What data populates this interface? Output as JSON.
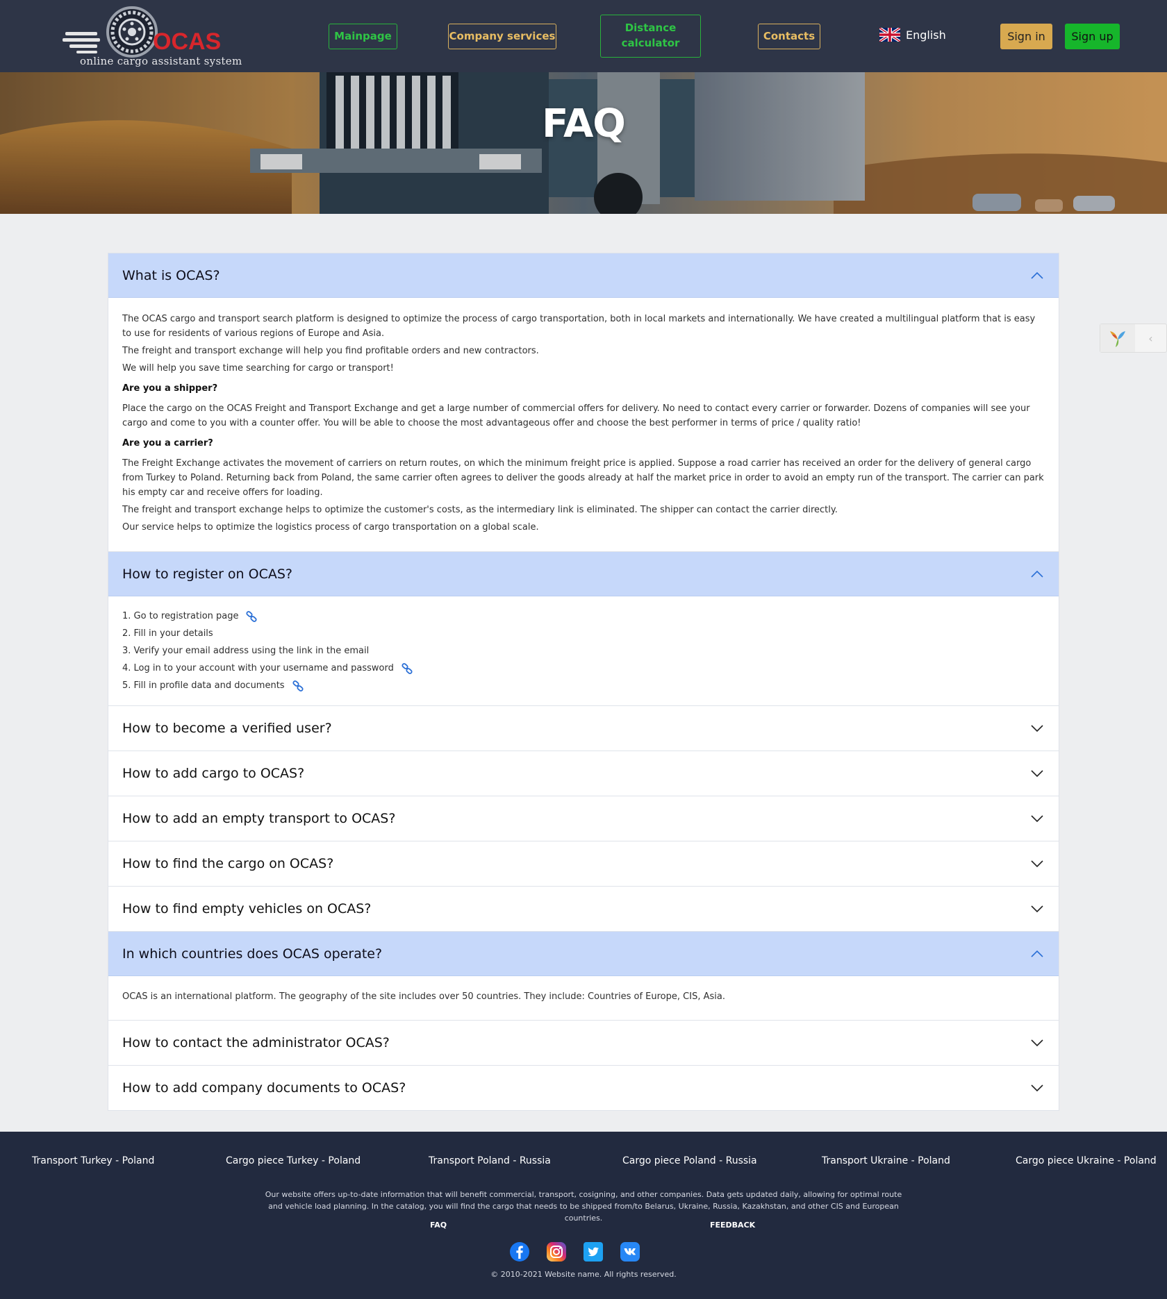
{
  "header": {
    "logo_text": "OCAS",
    "logo_tagline": "online cargo assistant system",
    "nav": {
      "mainpage": "Mainpage",
      "company_services": "Company services",
      "distance_line1": "Distance",
      "distance_line2": "calculator",
      "contacts": "Contacts"
    },
    "language": "English",
    "signin": "Sign in",
    "signup": "Sign up"
  },
  "hero": {
    "title": "FAQ"
  },
  "faq": {
    "q1": {
      "question": "What is OCAS?",
      "p1": "The OCAS cargo and transport search platform is designed to optimize the process of cargo transportation, both in local markets and internationally. We have created a multilingual platform that is easy to use for residents of various regions of Europe and Asia.",
      "p2": "The freight and transport exchange will help you find profitable orders and new contractors.",
      "p3": "We will help you save time searching for cargo or transport!",
      "h_shipper": "Are you a shipper?",
      "p4": "Place the cargo on the OCAS Freight and Transport Exchange and get a large number of commercial offers for delivery. No need to contact every carrier or forwarder. Dozens of companies will see your cargo and come to you with a counter offer. You will be able to choose the most advantageous offer and choose the best performer in terms of price / quality ratio!",
      "h_carrier": "Are you a carrier?",
      "p5": "The Freight Exchange activates the movement of carriers on return routes, on which the minimum freight price is applied. Suppose a road carrier has received an order for the delivery of general cargo from Turkey to Poland. Returning back from Poland, the same carrier often agrees to deliver the goods already at half the market price in order to avoid an empty run of the transport. The carrier can park his empty car and receive offers for loading.",
      "p6": "The freight and transport exchange helps to optimize the customer's costs, as the intermediary link is eliminated. The shipper can contact the carrier directly.",
      "p7": "Our service helps to optimize the logistics process of cargo transportation on a global scale."
    },
    "q2": {
      "question": "How to register on OCAS?",
      "steps": [
        "1. Go to registration page",
        "2. Fill in your details",
        "3. Verify your email address using the link in the email",
        "4. Log in to your account with your username and password",
        "5. Fill in profile data and documents"
      ]
    },
    "q3": {
      "question": "How to become a verified user?"
    },
    "q4": {
      "question": "How to add cargo to OCAS?"
    },
    "q5": {
      "question": "How to add an empty transport to OCAS?"
    },
    "q6": {
      "question": "How to find the cargo on OCAS?"
    },
    "q7": {
      "question": "How to find empty vehicles on OCAS?"
    },
    "q8": {
      "question": "In which countries does OCAS operate?",
      "answer": "OCAS is an international platform. The geography of the site includes over 50 countries. They include: Countries of Europe, CIS, Asia."
    },
    "q9": {
      "question": "How to contact the administrator OCAS?"
    },
    "q10": {
      "question": "How to add company documents to OCAS?"
    }
  },
  "footer": {
    "links": [
      "Transport Turkey - Poland",
      "Cargo piece Turkey - Poland",
      "Transport Poland - Russia",
      "Cargo piece Poland - Russia",
      "Transport Ukraine - Poland",
      "Cargo piece Ukraine - Poland"
    ],
    "text": "Our website offers up-to-date information that will benefit commercial, transport, cosigning, and other companies. Data gets updated daily, allowing for optimal route and vehicle load planning. In the catalog, you will find the cargo that needs to be shipped from/to Belarus, Ukraine, Russia, Kazakhstan, and other CIS and European countries.",
    "faq_link": "FAQ",
    "feedback_link": "FEEDBACK",
    "copyright": "© 2010-2021 Website name. All rights reserved."
  },
  "colors": {
    "header_bg": "#2e3547",
    "footer_bg": "#222a3f",
    "nav_green": "#2fc545",
    "nav_gold": "#e8bd63",
    "signin_bg": "#d8a950",
    "signup_bg": "#16b62b",
    "faq_open_bg": "#c6d8fa",
    "logo_red": "#d8262c"
  },
  "icons": {
    "chevron_up": "chevron-up-icon",
    "chevron_down": "chevron-down-icon",
    "link": "link-icon",
    "flag": "uk-flag-icon",
    "socials": [
      "facebook-icon",
      "instagram-icon",
      "twitter-icon",
      "vk-icon"
    ]
  }
}
